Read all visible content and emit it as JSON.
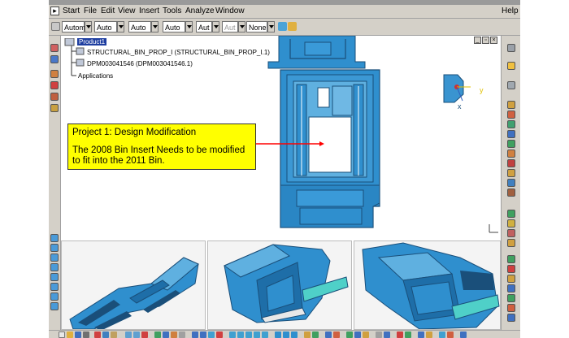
{
  "menubar": {
    "items": [
      "Start",
      "File",
      "Edit",
      "View",
      "Insert",
      "Tools",
      "Analyze",
      "Window"
    ],
    "help": "Help"
  },
  "toolbar": {
    "combos": [
      "Autom",
      "Auto",
      "Auto",
      "Auto",
      "Aut",
      "Aut",
      "None"
    ]
  },
  "tree": {
    "root": "Product1",
    "children": [
      "STRUCTURAL_BIN_PROP_I (STRUCTURAL_BIN_PROP_I.1)",
      "DPM003041546 (DPM003041546.1)",
      "Applications"
    ]
  },
  "callout": {
    "title": "Project 1: Design Modification",
    "body": "The  2008 Bin Insert Needs to be modified to fit into the 2011 Bin."
  },
  "compass": {
    "axis_y": "y",
    "axis_x": "x"
  },
  "colors": {
    "model_blue": "#2f8fce",
    "model_dark": "#1a4f7a",
    "callout_bg": "#ffff00",
    "arrow": "#ff0000",
    "menu_bg": "#d4d0c8"
  }
}
